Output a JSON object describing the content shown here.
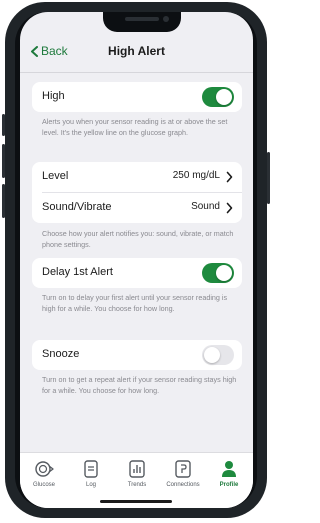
{
  "nav": {
    "back_label": "Back",
    "title": "High Alert"
  },
  "high": {
    "label": "High",
    "enabled": true,
    "help": "Alerts you when your sensor reading is at or above the set level. It's the yellow line on the glucose graph."
  },
  "settings": {
    "level": {
      "label": "Level",
      "value": "250 mg/dL"
    },
    "sound": {
      "label": "Sound/Vibrate",
      "value": "Sound"
    },
    "help": "Choose how your alert notifies you: sound, vibrate, or match phone settings."
  },
  "delay": {
    "label": "Delay 1st Alert",
    "enabled": true,
    "help": "Turn on to delay your first alert until your sensor reading is high for a while. You choose for how long."
  },
  "snooze": {
    "label": "Snooze",
    "enabled": false,
    "help": "Turn on to get a repeat alert if your sensor reading stays high for a while. You choose for how long."
  },
  "tabs": [
    {
      "label": "Glucose",
      "icon": "glucose-icon"
    },
    {
      "label": "Log",
      "icon": "log-icon"
    },
    {
      "label": "Trends",
      "icon": "trends-icon"
    },
    {
      "label": "Connections",
      "icon": "connections-icon"
    },
    {
      "label": "Profile",
      "icon": "profile-icon",
      "active": true
    }
  ],
  "colors": {
    "accent": "#1e8a3e",
    "background": "#efeff3",
    "toggle_off": "#e6e6ea"
  }
}
